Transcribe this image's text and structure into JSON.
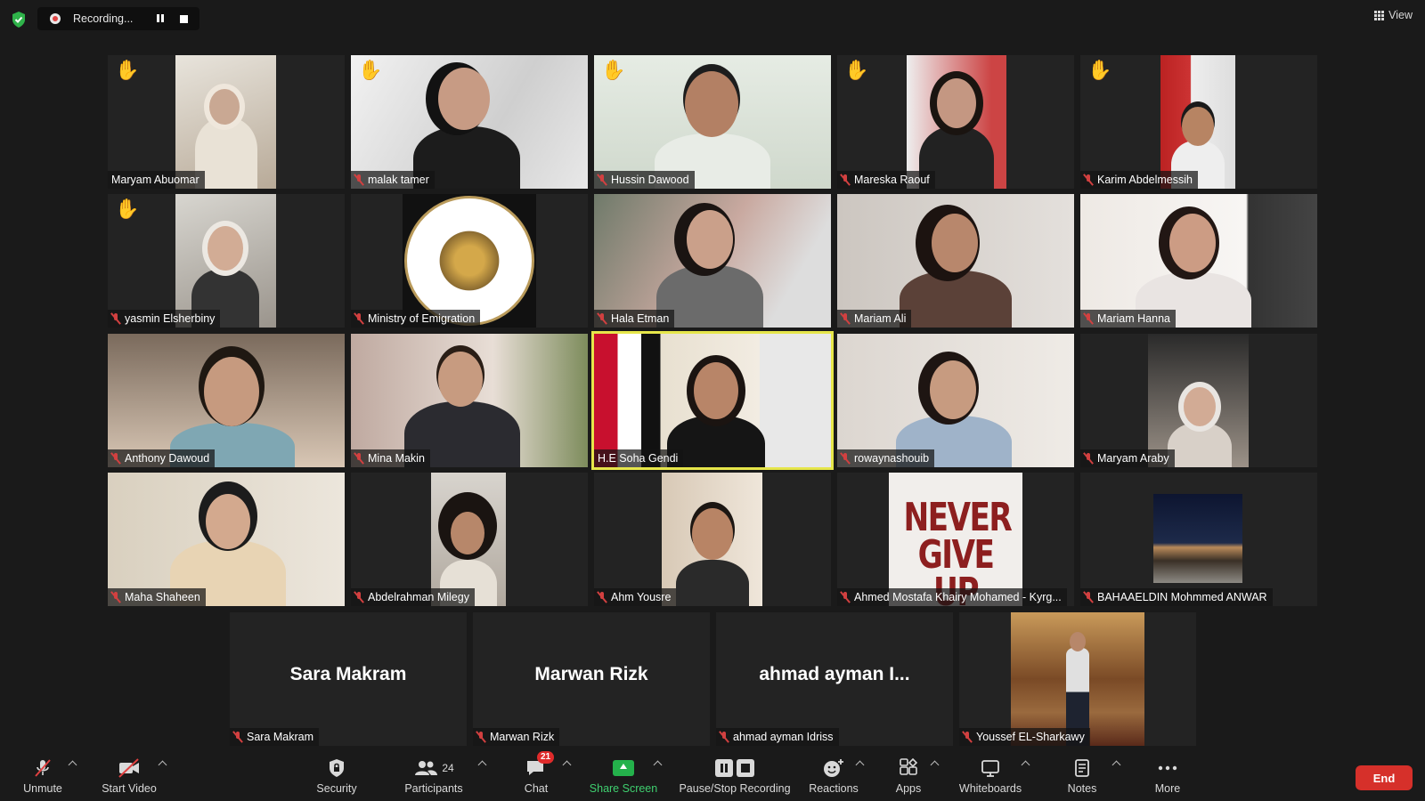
{
  "top_bar": {
    "recording_text": "Recording...",
    "view_label": "View"
  },
  "participants": [
    {
      "name": "Maryam Abuomar",
      "hand_raised": true
    },
    {
      "name": "malak tamer",
      "hand_raised": true
    },
    {
      "name": "Hussin Dawood",
      "hand_raised": true
    },
    {
      "name": "Mareska Raouf",
      "hand_raised": true
    },
    {
      "name": "Karim Abdelmessih",
      "hand_raised": true
    },
    {
      "name": "yasmin Elsherbiny",
      "hand_raised": true
    },
    {
      "name": "Ministry of Emigration",
      "hand_raised": false
    },
    {
      "name": "Hala Etman",
      "hand_raised": false
    },
    {
      "name": "Mariam Ali",
      "hand_raised": false
    },
    {
      "name": "Mariam Hanna",
      "hand_raised": false
    },
    {
      "name": "Anthony Dawoud",
      "hand_raised": false
    },
    {
      "name": "Mina Makin",
      "hand_raised": false
    },
    {
      "name": "H.E Soha Gendi",
      "hand_raised": false,
      "active_speaker": true
    },
    {
      "name": "rowaynashouib",
      "hand_raised": false
    },
    {
      "name": "Maryam Araby",
      "hand_raised": false
    },
    {
      "name": "Maha Shaheen",
      "hand_raised": false
    },
    {
      "name": "Abdelrahman Milegy",
      "hand_raised": false
    },
    {
      "name": "Ahm Yousre",
      "hand_raised": false
    },
    {
      "name": "Ahmed Mostafa Khairy Mohamed - Kyrg...",
      "hand_raised": false,
      "tile_image_text": "NEVER GIVE UP"
    },
    {
      "name": "BAHAAELDIN Mohmmed ANWAR",
      "hand_raised": false
    },
    {
      "name": "Sara Makram",
      "hand_raised": false,
      "video_off_display": "Sara Makram"
    },
    {
      "name": "Marwan Rizk",
      "hand_raised": false,
      "video_off_display": "Marwan Rizk"
    },
    {
      "name": "ahmad ayman Idriss",
      "hand_raised": false,
      "video_off_display": "ahmad ayman I..."
    },
    {
      "name": "Youssef EL-Sharkawy",
      "hand_raised": false
    }
  ],
  "toolbar": {
    "unmute": "Unmute",
    "start_video": "Start Video",
    "security": "Security",
    "participants": "Participants",
    "participants_count": "24",
    "chat": "Chat",
    "chat_badge": "21",
    "share_screen": "Share Screen",
    "pause_stop_recording": "Pause/Stop Recording",
    "reactions": "Reactions",
    "apps": "Apps",
    "whiteboards": "Whiteboards",
    "notes": "Notes",
    "more": "More",
    "end": "End"
  },
  "colors": {
    "background": "#1a1a1a",
    "tile": "#232323",
    "active_speaker_border": "#e6e64a",
    "share_green": "#24b14b",
    "end_red": "#d6302a",
    "muted_red": "#d24040"
  }
}
